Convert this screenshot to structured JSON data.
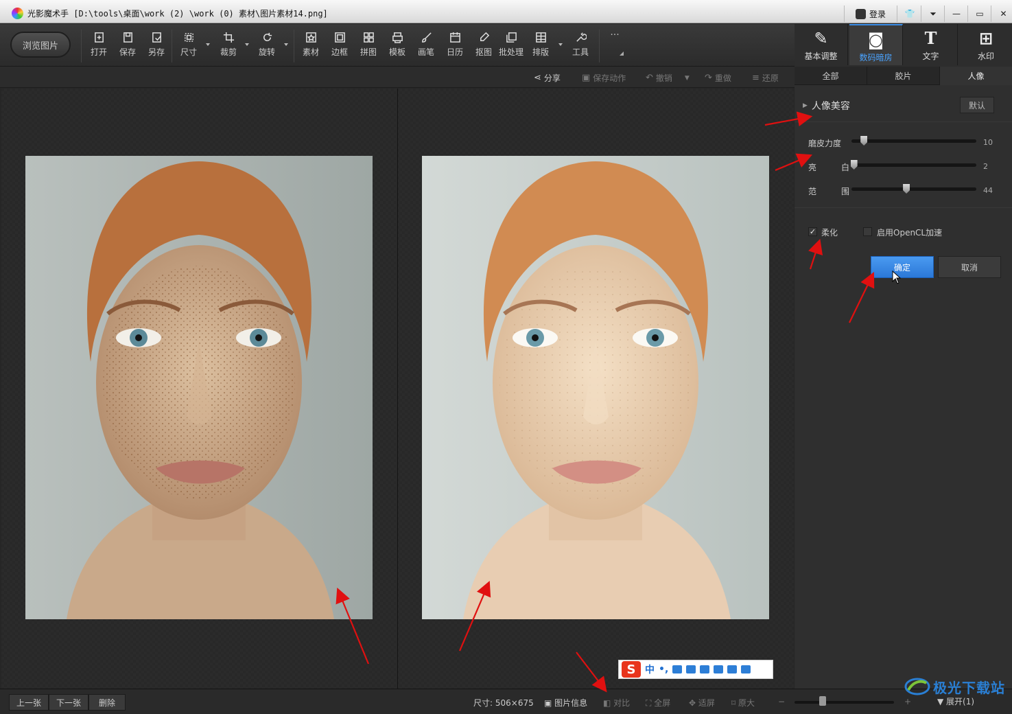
{
  "window": {
    "app_name": "光影魔术手",
    "file_path": "[D:\\tools\\桌面\\work (2) \\work (0) 素材\\图片素材14.png]",
    "login_label": "登录",
    "controls": [
      "shirt-icon",
      "menu-icon",
      "minimize-icon",
      "maximize-icon",
      "close-icon"
    ]
  },
  "toolbar": {
    "browse_label": "浏览图片",
    "tools": [
      {
        "label": "打开",
        "icon": "open-icon"
      },
      {
        "label": "保存",
        "icon": "save-icon"
      },
      {
        "label": "另存",
        "icon": "save-as-icon"
      },
      {
        "label": "尺寸",
        "icon": "resize-icon"
      },
      {
        "label": "裁剪",
        "icon": "crop-icon"
      },
      {
        "label": "旋转",
        "icon": "rotate-icon"
      },
      {
        "label": "素材",
        "icon": "material-icon"
      },
      {
        "label": "边框",
        "icon": "border-icon"
      },
      {
        "label": "拼图",
        "icon": "collage-icon"
      },
      {
        "label": "模板",
        "icon": "template-icon"
      },
      {
        "label": "画笔",
        "icon": "brush-icon"
      },
      {
        "label": "日历",
        "icon": "calendar-icon"
      },
      {
        "label": "抠图",
        "icon": "cutout-icon"
      },
      {
        "label": "批处理",
        "icon": "batch-icon"
      },
      {
        "label": "排版",
        "icon": "layout-icon"
      },
      {
        "label": "工具",
        "icon": "wrench-icon"
      }
    ],
    "more_label": "···"
  },
  "right_tabs": [
    {
      "label": "基本调整",
      "icon": "basic-adjust-icon"
    },
    {
      "label": "数码暗房",
      "icon": "darkroom-icon"
    },
    {
      "label": "文字",
      "icon": "text-icon"
    },
    {
      "label": "水印",
      "icon": "watermark-icon"
    }
  ],
  "active_right_tab": 1,
  "subbar": {
    "share": "分享",
    "save_action": "保存动作",
    "undo": "撤销",
    "redo": "重做",
    "restore": "还原"
  },
  "panel": {
    "subtabs": [
      "全部",
      "胶片",
      "人像"
    ],
    "active_subtab": 2,
    "section_title": "人像美容",
    "default_label": "默认",
    "sliders": [
      {
        "label": "磨皮力度",
        "label2": "",
        "value": 10,
        "max": 100
      },
      {
        "label": "亮",
        "label2": "白",
        "value": 2,
        "max": 100
      },
      {
        "label": "范",
        "label2": "围",
        "value": 44,
        "max": 100
      }
    ],
    "soften_label": "柔化",
    "soften_checked": true,
    "soften_mark": "✓",
    "opencl_label": "启用OpenCL加速",
    "opencl_checked": false,
    "ok_label": "确定",
    "cancel_label": "取消"
  },
  "ime": {
    "logo": "S",
    "mode": "中",
    "punct": "•,"
  },
  "statusbar": {
    "prev": "上一张",
    "next": "下一张",
    "delete": "删除",
    "size": "尺寸: 506×675",
    "info": "图片信息",
    "compare": "对比",
    "fullscreen": "全屏",
    "fit": "适屏",
    "original": "原大",
    "zoom_minus": "−",
    "zoom_plus": "+",
    "zoom_fraction": 0.28,
    "expand": "展开(1)"
  },
  "watermark_text": "极光下载站",
  "colors": {
    "accent": "#3b8ee8",
    "annotation_arrow": "#e01010"
  }
}
